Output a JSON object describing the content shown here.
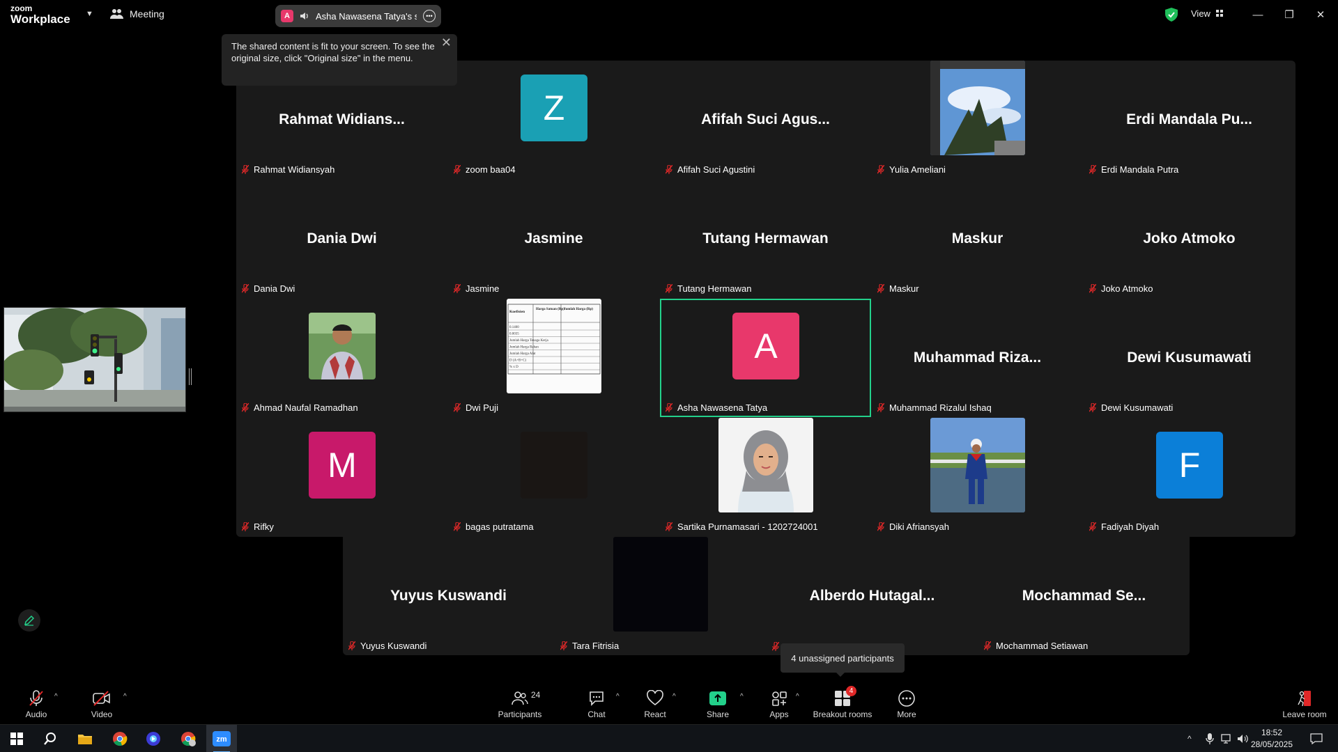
{
  "app": {
    "brand_top": "zoom",
    "brand_bottom": "Workplace",
    "meeting_label": "Meeting",
    "share_indicator": {
      "avatar_letter": "A",
      "text": "Asha Nawasena Tatya's scree"
    },
    "view_label": "View"
  },
  "fit_tooltip": {
    "text": "The shared content is fit to your screen. To see the original size, click \"Original size\" in the menu."
  },
  "participants": [
    {
      "display": "Rahmat  Widians...",
      "name": "Rahmat Widiansyah",
      "kind": "text"
    },
    {
      "display": "Z",
      "name": "zoom baa04",
      "kind": "avatar",
      "color": "#1aa0b4"
    },
    {
      "display": "Afifah  Suci  Agus...",
      "name": "Afifah Suci Agustini",
      "kind": "text"
    },
    {
      "display": "",
      "name": "Yulia Ameliani",
      "kind": "photo-sky"
    },
    {
      "display": "Erdi  Mandala  Pu...",
      "name": "Erdi Mandala Putra",
      "kind": "text"
    },
    {
      "display": "Dania  Dwi",
      "name": "Dania Dwi",
      "kind": "text"
    },
    {
      "display": "Jasmine",
      "name": "Jasmine",
      "kind": "text"
    },
    {
      "display": "Tutang  Hermawan",
      "name": "Tutang Hermawan",
      "kind": "text"
    },
    {
      "display": "Maskur",
      "name": "Maskur",
      "kind": "text"
    },
    {
      "display": "Joko  Atmoko",
      "name": "Joko Atmoko",
      "kind": "text"
    },
    {
      "display": "",
      "name": "Ahmad Naufal Ramadhan",
      "kind": "photo-person"
    },
    {
      "display": "",
      "name": "Dwi Puji",
      "kind": "photo-doc"
    },
    {
      "display": "A",
      "name": "Asha Nawasena Tatya",
      "kind": "avatar",
      "color": "#e8386b",
      "active": true
    },
    {
      "display": "Muhammad  Riza...",
      "name": "Muhammad Rizalul Ishaq",
      "kind": "text"
    },
    {
      "display": "Dewi  Kusumawati",
      "name": "Dewi Kusumawati",
      "kind": "text"
    },
    {
      "display": "M",
      "name": "Rifky",
      "kind": "avatar",
      "color": "#c8196a"
    },
    {
      "display": "",
      "name": "bagas putratama",
      "kind": "photo-dark"
    },
    {
      "display": "",
      "name": "Sartika Purnamasari - 1202724001",
      "kind": "photo-hijab"
    },
    {
      "display": "",
      "name": "Diki Afriansyah",
      "kind": "photo-worker"
    },
    {
      "display": "F",
      "name": "Fadiyah Diyah",
      "kind": "avatar",
      "color": "#0b7fd8"
    },
    {
      "display": "Yuyus  Kuswandi",
      "name": "Yuyus Kuswandi",
      "kind": "text"
    },
    {
      "display": "",
      "name": "Tara Fitrisia",
      "kind": "photo-black"
    },
    {
      "display": "Alberdo  Hutagal...",
      "name": "",
      "kind": "text"
    },
    {
      "display": "Mochammad  Se...",
      "name": "Mochammad Setiawan",
      "kind": "text"
    }
  ],
  "doc_thumb": {
    "col1": "Koefisien",
    "col2": "Harga Satuan (Rp)",
    "col3": "Jumlah Harga (Rp)",
    "rows": [
      "0.1400",
      "0.0035",
      "Jumlah Harga Tenaga Kerja",
      "Jumlah Harga Bahan",
      "Jumlah Harga Alat",
      "D (A+B+C)",
      "% x D"
    ]
  },
  "unassigned_tooltip": "4 unassigned participants",
  "toolbar": {
    "audio": "Audio",
    "video": "Video",
    "participants": "Participants",
    "participants_count": "24",
    "chat": "Chat",
    "react": "React",
    "share": "Share",
    "apps": "Apps",
    "breakout": "Breakout rooms",
    "breakout_badge": "4",
    "more": "More",
    "leave": "Leave room"
  },
  "taskbar": {
    "time": "18:52",
    "date": "28/05/2025"
  },
  "colors": {
    "share_green": "#23d18b",
    "shield_green": "#1fbf5a",
    "active_border": "#23d18b",
    "leave_red": "#e02828"
  }
}
